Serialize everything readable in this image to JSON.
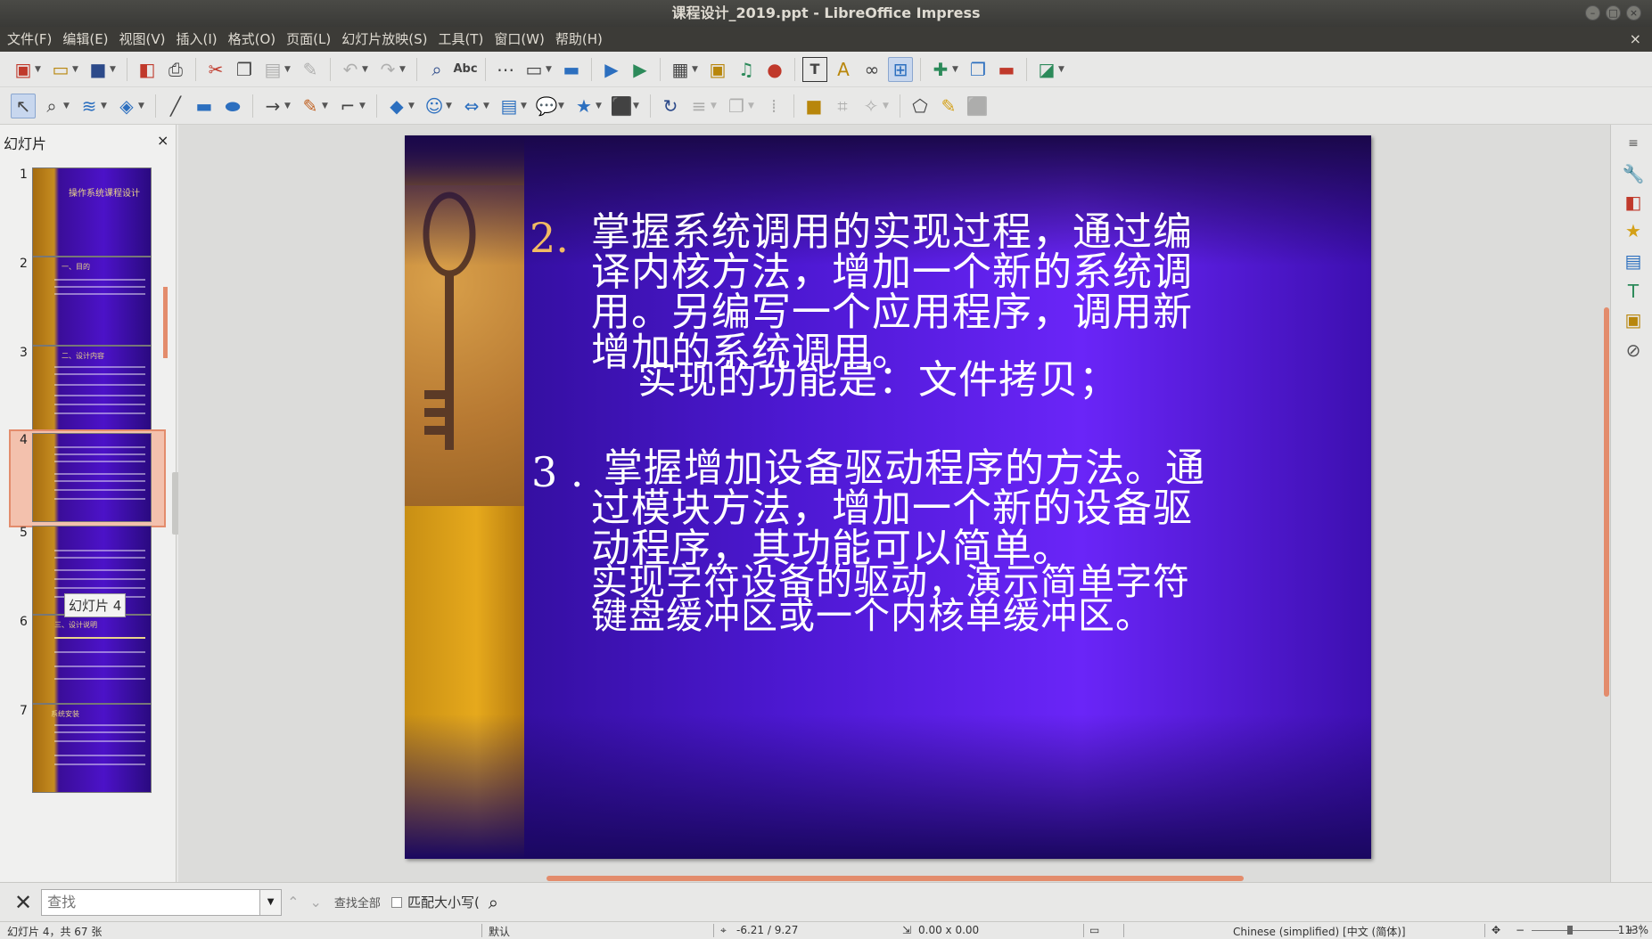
{
  "window": {
    "title": "课程设计_2019.ppt - LibreOffice Impress"
  },
  "menu": [
    "文件(F)",
    "编辑(E)",
    "视图(V)",
    "插入(I)",
    "格式(O)",
    "页面(L)",
    "幻灯片放映(S)",
    "工具(T)",
    "窗口(W)",
    "帮助(H)"
  ],
  "toolbar": {
    "spellcheck_label": "Abc",
    "text_label": "T"
  },
  "panel": {
    "title": "幻灯片",
    "close": "×"
  },
  "thumbnails": [
    {
      "num": "1",
      "title": "操作系统课程设计"
    },
    {
      "num": "2",
      "title": "一、目的"
    },
    {
      "num": "3",
      "title": "二、设计内容"
    },
    {
      "num": "4",
      "title": ""
    },
    {
      "num": "5",
      "title": ""
    },
    {
      "num": "6",
      "title": "三、设计说明"
    },
    {
      "num": "7",
      "title": "系统安装"
    }
  ],
  "tooltip": "幻灯片 4",
  "slide": {
    "item2_num": "2.",
    "item2_text": "掌握系统调用的实现过程，通过编译内核方法，增加一个新的系统调用。另编写一个应用程序，调用新增加的系统调用。",
    "item2_sub": "实现的功能是：文件拷贝；",
    "item3_num": "3 .",
    "item3_text": "掌握增加设备驱动程序的方法。通过模块方法，增加一个新的设备驱动程序，其功能可以简单。",
    "item3_sub": "实现字符设备的驱动，演示简单字符键盘缓冲区或一个内核单缓冲区。"
  },
  "find": {
    "placeholder": "查找",
    "find_all": "查找全部",
    "match_case": "匹配大小写("
  },
  "status": {
    "slide": "幻灯片 4，共 67 张",
    "layout": "默认",
    "position": "-6.21 / 9.27",
    "size": "0.00 x 0.00",
    "language": "Chinese (simplified) [中文 (简体)]",
    "zoom": "113%"
  }
}
